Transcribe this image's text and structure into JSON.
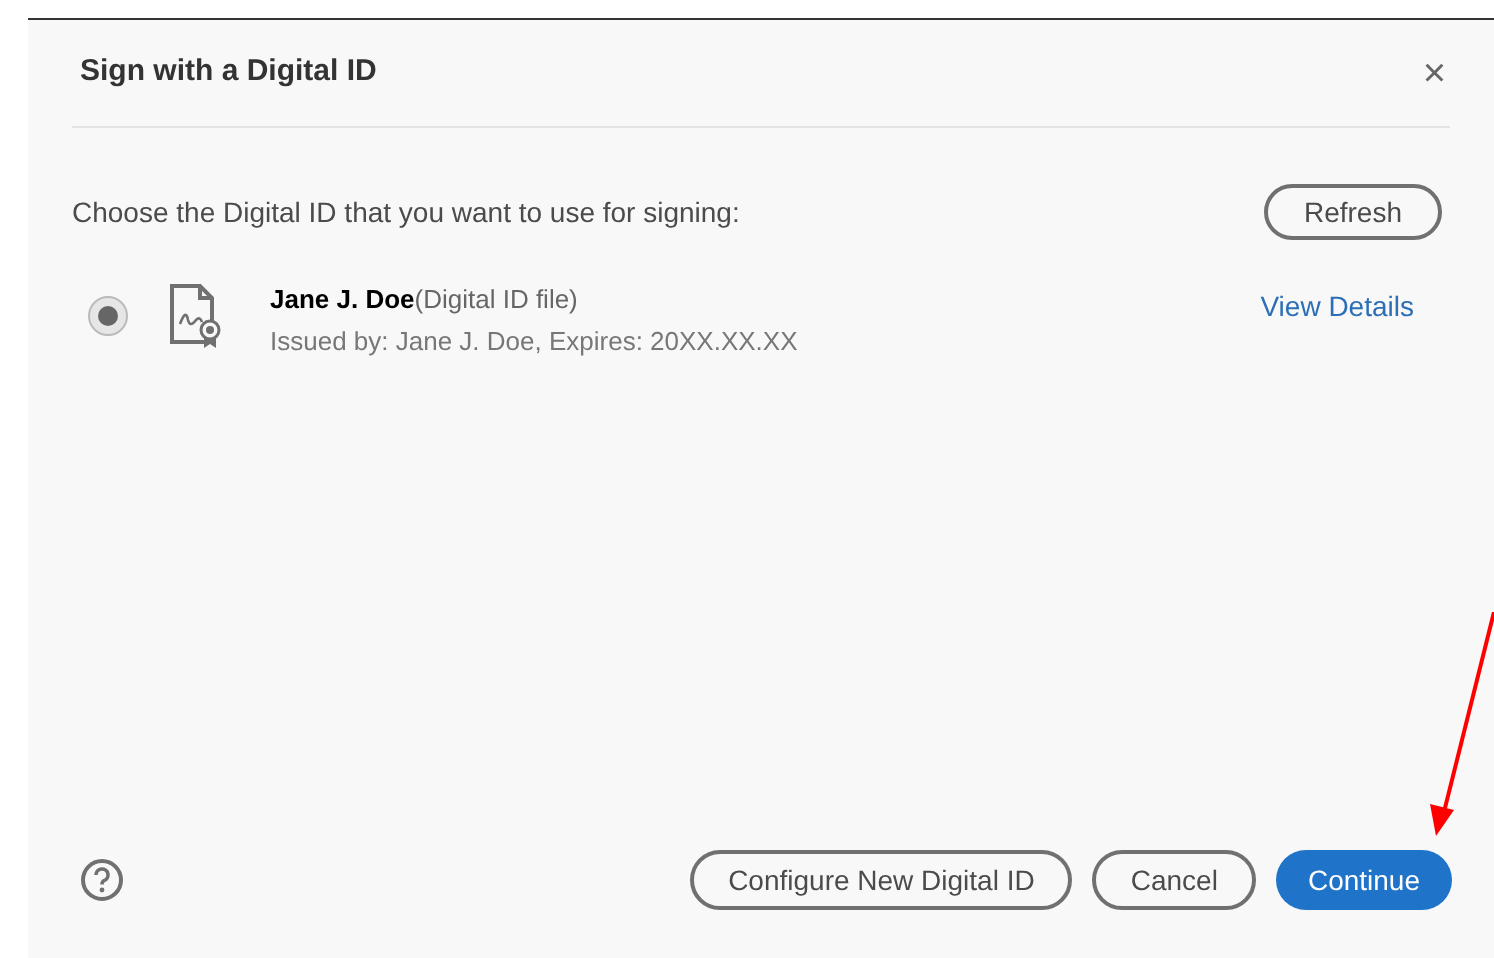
{
  "dialog": {
    "title": "Sign with a Digital ID",
    "close": "×"
  },
  "prompt": "Choose the Digital ID that you want to use for signing:",
  "refresh_button": "Refresh",
  "ids": [
    {
      "name": "Jane J. Doe",
      "type": "(Digital ID file)",
      "issued": "Issued by: Jane J. Doe, Expires: 20XX.XX.XX",
      "link": "View Details",
      "selected": true
    }
  ],
  "buttons": [
    {
      "label": "Configure New Digital ID",
      "kind": "secondary"
    },
    {
      "label": "Cancel",
      "kind": "secondary"
    },
    {
      "label": "Continue",
      "kind": "primary"
    }
  ]
}
